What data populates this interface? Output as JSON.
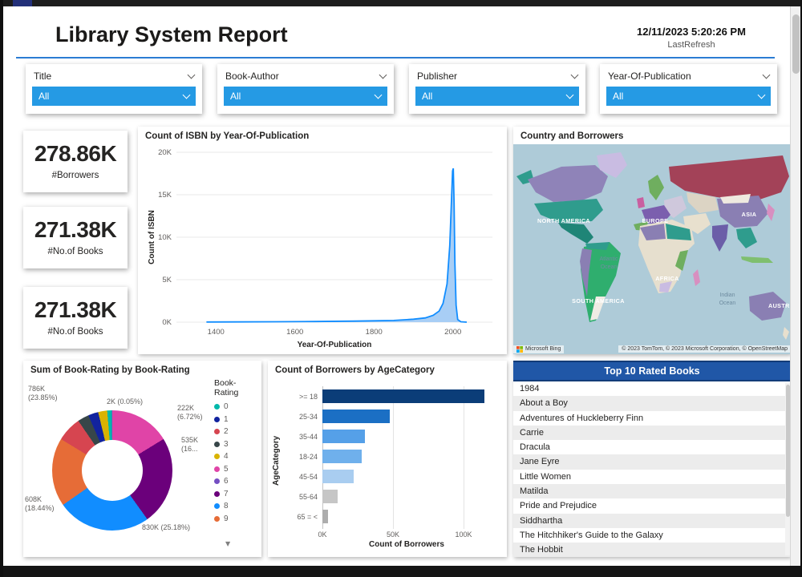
{
  "header": {
    "title": "Library System Report",
    "timestamp": "12/11/2023 5:20:26 PM",
    "refresh_label": "LastRefresh"
  },
  "filters": [
    {
      "label": "Title",
      "value": "All"
    },
    {
      "label": "Book-Author",
      "value": "All"
    },
    {
      "label": "Publisher",
      "value": "All"
    },
    {
      "label": "Year-Of-Publication",
      "value": "All"
    }
  ],
  "kpis": [
    {
      "value": "278.86K",
      "label": "#Borrowers"
    },
    {
      "value": "271.38K",
      "label": "#No.of Books"
    },
    {
      "value": "271.38K",
      "label": "#No.of Books"
    }
  ],
  "map": {
    "title": "Country and Borrowers",
    "labels": {
      "north_america": "NORTH AMERICA",
      "south_america": "SOUTH AMERICA",
      "europe": "EUROPE",
      "asia": "ASIA",
      "africa": "AFRICA",
      "australia": "AUSTRALIA"
    },
    "ocean_labels": {
      "atlantic_1": "Atlantic",
      "atlantic_2": "Ocean",
      "indian_1": "Indian",
      "indian_2": "Ocean"
    },
    "provider": "Microsoft Bing",
    "attribution": "© 2023 TomTom, © 2023 Microsoft Corporation, © OpenStreetMap"
  },
  "chart_data": [
    {
      "id": "isbn-by-year",
      "type": "area",
      "title": "Count of ISBN by Year-Of-Publication",
      "xlabel": "Year-Of-Publication",
      "ylabel": "Count of ISBN",
      "xlim": [
        1300,
        2100
      ],
      "ylim": [
        0,
        20
      ],
      "y_unit": "K",
      "yticks": [
        {
          "label": "0K",
          "value": 0
        },
        {
          "label": "5K",
          "value": 5
        },
        {
          "label": "10K",
          "value": 10
        },
        {
          "label": "15K",
          "value": 15
        },
        {
          "label": "20K",
          "value": 20
        }
      ],
      "xticks": [
        {
          "label": "1400",
          "value": 1400
        },
        {
          "label": "1600",
          "value": 1600
        },
        {
          "label": "1800",
          "value": 1800
        },
        {
          "label": "2000",
          "value": 2000
        }
      ],
      "line_color": "#118DFF",
      "fill_color": "#A8CEF5",
      "points": [
        {
          "x": 1376,
          "y": 0.02
        },
        {
          "x": 1450,
          "y": 0.03
        },
        {
          "x": 1550,
          "y": 0.05
        },
        {
          "x": 1650,
          "y": 0.08
        },
        {
          "x": 1750,
          "y": 0.12
        },
        {
          "x": 1850,
          "y": 0.2
        },
        {
          "x": 1900,
          "y": 0.35
        },
        {
          "x": 1930,
          "y": 0.5
        },
        {
          "x": 1950,
          "y": 0.8
        },
        {
          "x": 1965,
          "y": 1.3
        },
        {
          "x": 1975,
          "y": 2.2
        },
        {
          "x": 1985,
          "y": 4.5
        },
        {
          "x": 1992,
          "y": 9
        },
        {
          "x": 1996,
          "y": 14
        },
        {
          "x": 1999,
          "y": 17.8
        },
        {
          "x": 2001,
          "y": 18.1
        },
        {
          "x": 2003,
          "y": 14
        },
        {
          "x": 2005,
          "y": 7
        },
        {
          "x": 2008,
          "y": 2
        },
        {
          "x": 2012,
          "y": 0.3
        },
        {
          "x": 2020,
          "y": 0.05
        },
        {
          "x": 2035,
          "y": 0
        }
      ]
    },
    {
      "id": "rating-donut",
      "type": "pie",
      "title": "Sum of Book-Rating by Book-Rating",
      "legend_title": "Book-Rating",
      "segments": [
        {
          "label": "5",
          "value": "535K",
          "pct": 16.25,
          "color": "#E044A7"
        },
        {
          "label": "7",
          "value": "786K",
          "pct": 23.85,
          "color": "#6B007B"
        },
        {
          "label": "8",
          "value": "830K",
          "pct": 25.18,
          "color": "#118DFF"
        },
        {
          "label": "9",
          "value": "608K",
          "pct": 18.44,
          "color": "#E66C37"
        },
        {
          "label": "2",
          "value": "222K",
          "pct": 6.72,
          "color": "#D64550"
        },
        {
          "label": "3",
          "value": "100K",
          "pct": 3.04,
          "color": "#374649"
        },
        {
          "label": "1",
          "value": "90K",
          "pct": 2.73,
          "color": "#12239E"
        },
        {
          "label": "4",
          "value": "80K",
          "pct": 2.43,
          "color": "#D9B300"
        },
        {
          "label": "0",
          "value": "42K",
          "pct": 1.26,
          "color": "#01B8AA"
        },
        {
          "label": "6",
          "value": "2K",
          "pct": 0.05,
          "color": "#744EC2"
        }
      ],
      "callouts": {
        "top_left": "786K\n(23.85%)",
        "top": "2K (0.05%)",
        "right_upper": "222K\n(6.72%)",
        "right_lower": "535K\n(16...",
        "bottom": "830K (25.18%)",
        "left": "608K\n(18.44%)"
      }
    },
    {
      "id": "borrowers-by-age",
      "type": "bar",
      "title": "Count of Borrowers by AgeCategory",
      "xlabel": "Count of Borrowers",
      "ylabel": "AgeCategory",
      "axis_max": 125,
      "xticks": [
        {
          "label": "0K",
          "value": 0
        },
        {
          "label": "50K",
          "value": 50
        },
        {
          "label": "100K",
          "value": 100
        }
      ],
      "bars": [
        {
          "category": ">= 18",
          "value": 115,
          "color": "#0B3D78"
        },
        {
          "category": "25-34",
          "value": 48,
          "color": "#1B6FC4"
        },
        {
          "category": "35-44",
          "value": 30,
          "color": "#55A0E8"
        },
        {
          "category": "18-24",
          "value": 28,
          "color": "#6FB0EC"
        },
        {
          "category": "45-54",
          "value": 22,
          "color": "#A9CDF0"
        },
        {
          "category": "55-64",
          "value": 11,
          "color": "#C6C6C6"
        },
        {
          "category": "65 = <",
          "value": 4,
          "color": "#ADADAD"
        }
      ]
    },
    {
      "id": "top-rated-books",
      "type": "table",
      "title": "Top 10 Rated Books",
      "rows": [
        "1984",
        "About a Boy",
        "Adventures of Huckleberry Finn",
        "Carrie",
        "Dracula",
        "Jane Eyre",
        "Little Women",
        "Matilda",
        "Pride and Prejudice",
        "Siddhartha",
        "The Hitchhiker's Guide to the Galaxy",
        "The Hobbit"
      ]
    }
  ]
}
